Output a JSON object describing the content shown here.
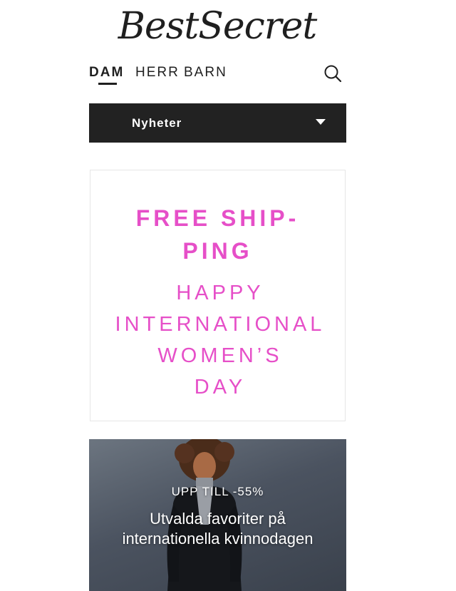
{
  "header": {
    "logo_text": "BestSecret"
  },
  "nav": {
    "tabs": [
      {
        "label": "DAM",
        "active": true
      },
      {
        "label": "HERR",
        "active": false
      },
      {
        "label": "BARN",
        "active": false
      }
    ],
    "search_icon": "search-icon"
  },
  "category_dropdown": {
    "selected": "Nyheter",
    "icon": "chevron-down-icon"
  },
  "promo": {
    "headline_line1": "FREE SHIP-",
    "headline_line2": "PING",
    "sub_line1": "HAPPY",
    "sub_line2": "INTERNATIONAL",
    "sub_line3": "WOMEN’S",
    "sub_line4": "DAY",
    "color": "#e64fc8"
  },
  "hero": {
    "kicker": "UPP TILL -55%",
    "title_line1": "Utvalda favoriter på",
    "title_line2": "internationella kvinnodagen"
  }
}
